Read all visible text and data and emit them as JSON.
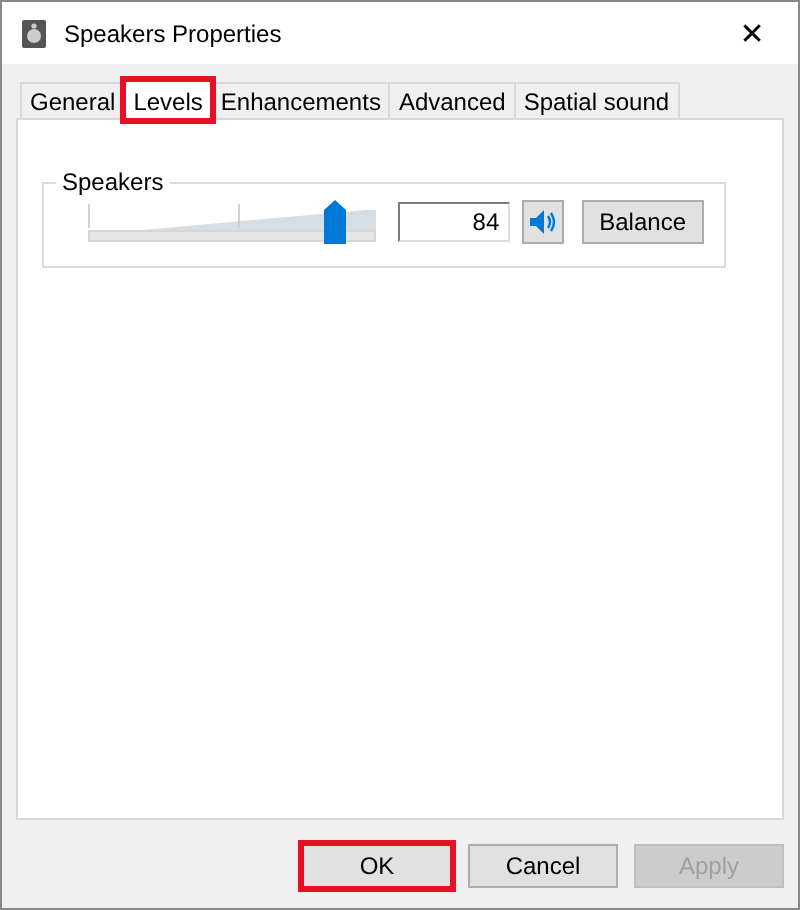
{
  "window": {
    "title": "Speakers Properties",
    "close": "✕"
  },
  "tabs": [
    {
      "label": "General",
      "selected": false,
      "highlighted": false
    },
    {
      "label": "Levels",
      "selected": true,
      "highlighted": true
    },
    {
      "label": "Enhancements",
      "selected": false,
      "highlighted": false
    },
    {
      "label": "Advanced",
      "selected": false,
      "highlighted": false
    },
    {
      "label": "Spatial sound",
      "selected": false,
      "highlighted": false
    }
  ],
  "levels": [
    {
      "name": "Speakers",
      "level": 0.84,
      "value": "84",
      "muted": false,
      "button": "Balance"
    }
  ],
  "buttons": [
    {
      "label": "OK",
      "disabled": false,
      "highlighted": true
    },
    {
      "label": "Cancel",
      "disabled": false,
      "highlighted": false
    },
    {
      "label": "Apply",
      "disabled": true,
      "highlighted": false
    }
  ]
}
